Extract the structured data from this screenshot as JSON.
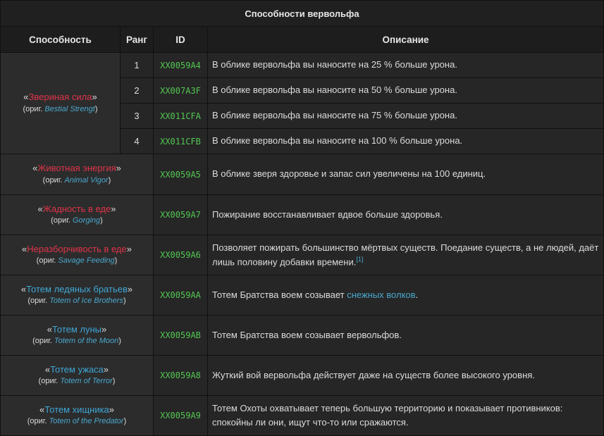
{
  "title": "Способности вервольфа",
  "headers": {
    "ability": "Способность",
    "rank": "Ранг",
    "id": "ID",
    "desc": "Описание"
  },
  "orig_label": "ориг.",
  "quote_open": "«",
  "quote_close": "»",
  "abilities": [
    {
      "name_ru": "Звериная сила",
      "name_en": "Bestial Strengt",
      "color": "red",
      "ranks": [
        {
          "rank": "1",
          "id_prefix": "XX",
          "id_code": "0059A4",
          "desc": "В облике вервольфа вы наносите на 25 % больше урона."
        },
        {
          "rank": "2",
          "id_prefix": "XX",
          "id_code": "007A3F",
          "desc": "В облике вервольфа вы наносите на 50 % больше урона."
        },
        {
          "rank": "3",
          "id_prefix": "XX",
          "id_code": "011CFA",
          "desc": "В облике вервольфа вы наносите на 75 % больше урона."
        },
        {
          "rank": "4",
          "id_prefix": "XX",
          "id_code": "011CFB",
          "desc": "В облике вервольфа вы наносите на 100 % больше урона."
        }
      ]
    },
    {
      "name_ru": "Животная энергия",
      "name_en": "Animal Vigor",
      "color": "red",
      "id_prefix": "XX",
      "id_code": "0059A5",
      "desc": "В облике зверя здоровье и запас сил увеличены на 100 единиц."
    },
    {
      "name_ru": "Жадность в еде",
      "name_en": "Gorging",
      "color": "red",
      "id_prefix": "XX",
      "id_code": "0059A7",
      "desc": "Пожирание восстанавливает вдвое больше здоровья."
    },
    {
      "name_ru": "Неразборчивость в еде",
      "name_en": "Savage Feeding",
      "color": "red",
      "id_prefix": "XX",
      "id_code": "0059A6",
      "desc": "Позволяет пожирать большинство мёртвых существ. Поедание существ, а не людей, даёт лишь половину добавки времени.",
      "footnote": "[1]"
    },
    {
      "name_ru": "Тотем ледяных братьев",
      "name_en": "Totem of Ice Brothers",
      "color": "blue",
      "id_prefix": "XX",
      "id_code": "0059AA",
      "desc_before": "Тотем Братства воем созывает ",
      "desc_link": "снежных волков",
      "desc_after": "."
    },
    {
      "name_ru": "Тотем луны",
      "name_en": "Totem of the Moon",
      "color": "blue",
      "id_prefix": "XX",
      "id_code": "0059AB",
      "desc": "Тотем Братства воем созывает вервольфов."
    },
    {
      "name_ru": "Тотем ужаса",
      "name_en": "Totem of Terror",
      "color": "blue",
      "id_prefix": "XX",
      "id_code": "0059A8",
      "desc": "Жуткий вой вервольфа действует даже на существ более высокого уровня."
    },
    {
      "name_ru": "Тотем хищника",
      "name_en": "Totem of the Predator",
      "color": "blue",
      "id_prefix": "XX",
      "id_code": "0059A9",
      "desc": "Тотем Охоты охватывает теперь большую территорию и показывает противников: спокойны ли они, ищут что-то или сражаются."
    }
  ]
}
